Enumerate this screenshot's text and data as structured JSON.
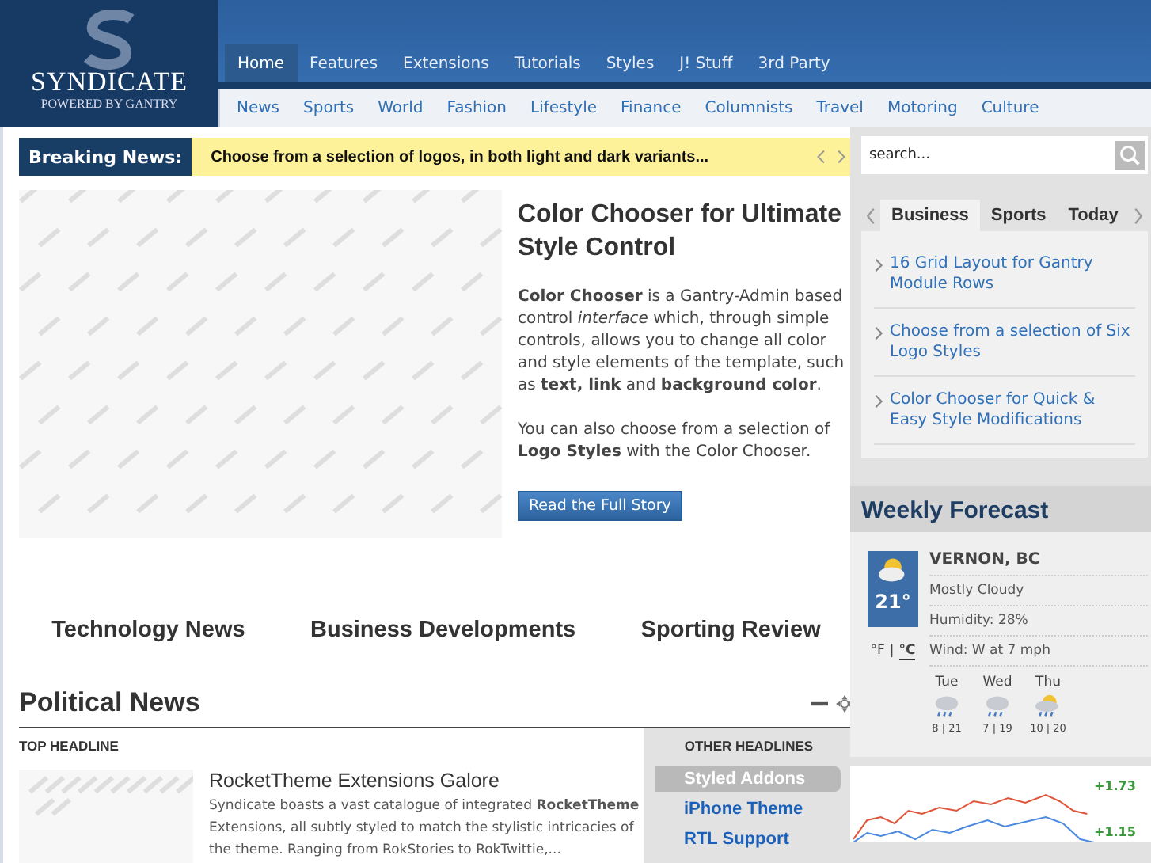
{
  "logo": {
    "title": "SYNDICATE",
    "subtitle": "POWERED BY GANTRY"
  },
  "nav": [
    {
      "label": "Home",
      "selected": true
    },
    {
      "label": "Features",
      "selected": false
    },
    {
      "label": "Extensions",
      "selected": false
    },
    {
      "label": "Tutorials",
      "selected": false
    },
    {
      "label": "Styles",
      "selected": false
    },
    {
      "label": "J! Stuff",
      "selected": false
    },
    {
      "label": "3rd Party",
      "selected": false
    }
  ],
  "subnav": [
    "News",
    "Sports",
    "World",
    "Fashion",
    "Lifestyle",
    "Finance",
    "Columnists",
    "Travel",
    "Motoring",
    "Culture"
  ],
  "breaking": {
    "label": "Breaking News:",
    "text": "Choose from a selection of logos, in both light and dark variants..."
  },
  "feature": {
    "title": "Color Chooser for Ultimate Style Control",
    "body": "**Color Chooser** is a Gantry-Admin based control *interface* which, through simple controls, allows you to change all color and style elements of the template, such as **text, link** and **background color**.",
    "body2": "You can also choose from a selection of **Logo Styles** with the Color Chooser.",
    "button": "Read the Full Story"
  },
  "categories": [
    "Technology News",
    "Business Developments",
    "Sporting Review"
  ],
  "political": {
    "title": "Political News",
    "top_label": "TOP HEADLINE",
    "headline": "RocketTheme Extensions Galore",
    "summary": "Syndicate boasts a vast catalogue of integrated **RocketTheme** Extensions, all subtly styled to match the stylistic intricacies of the theme. Ranging from RokStories to RokTwittie,...",
    "other_label": "OTHER HEADLINES",
    "others": [
      {
        "label": "Styled Addons",
        "selected": true
      },
      {
        "label": "iPhone Theme",
        "selected": false
      },
      {
        "label": "RTL Support",
        "selected": false
      }
    ]
  },
  "sidebar": {
    "search": {
      "placeholder": "search..."
    },
    "tabs": [
      {
        "label": "Business",
        "selected": true
      },
      {
        "label": "Sports",
        "selected": false
      },
      {
        "label": "Today",
        "selected": false
      }
    ],
    "links": [
      "16 Grid Layout for Gantry Module Rows",
      "Choose from a selection of Six Logo Styles",
      "Color Chooser for Quick & Easy Style Modifications"
    ]
  },
  "weather": {
    "title": "Weekly Forecast",
    "city": "VERNON, BC",
    "condition": "Mostly Cloudy",
    "kind": "sun-cloud",
    "temp": "21°",
    "humidity": "Humidity: 28%",
    "wind": "Wind: W at 7 mph",
    "units": [
      {
        "label": "°F",
        "selected": false
      },
      {
        "label": "°C",
        "selected": true
      }
    ],
    "separator": "|",
    "days": [
      {
        "day": "Tue",
        "kind": "rain",
        "temps": "8 | 21"
      },
      {
        "day": "Wed",
        "kind": "rain",
        "temps": "7 | 19"
      },
      {
        "day": "Thu",
        "kind": "sun-rain",
        "temps": "10 | 20"
      }
    ]
  },
  "market": {
    "labels": [
      "+1.73",
      "+1.15"
    ]
  }
}
